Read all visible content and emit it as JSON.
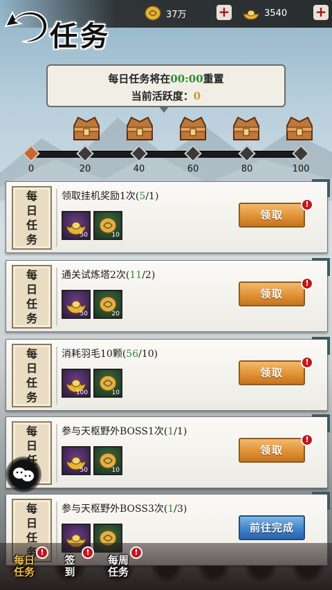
{
  "header": {
    "title": "任务",
    "currency": [
      {
        "icon": "gold-coin-icon",
        "amount": "37万"
      },
      {
        "icon": "gold-ingot-icon",
        "amount": "3540"
      }
    ]
  },
  "notice": {
    "line1_prefix": "每日任务将在",
    "reset_time": "00:00",
    "line1_suffix": "重置",
    "line2_prefix": "当前活跃度：",
    "activity": "0"
  },
  "progress": {
    "milestones": [
      "0",
      "20",
      "40",
      "60",
      "80",
      "100"
    ],
    "current": 0
  },
  "tasks": [
    {
      "tag": [
        "每",
        "日",
        "任",
        "务"
      ],
      "name": "领取挂机奖励1次",
      "done": "5",
      "total": "/1",
      "rewards": [
        {
          "icon": "gold-ingot-icon",
          "count": "50"
        },
        {
          "icon": "copper-coin-icon",
          "count": "10"
        }
      ],
      "button": "领取"
    },
    {
      "tag": [
        "每",
        "日",
        "任",
        "务"
      ],
      "name": "通关试炼塔2次",
      "done": "11",
      "total": "/2",
      "rewards": [
        {
          "icon": "gold-ingot-icon",
          "count": "50"
        },
        {
          "icon": "copper-coin-icon",
          "count": "20"
        }
      ],
      "button": "领取"
    },
    {
      "tag": [
        "每",
        "日",
        "任",
        "务"
      ],
      "name": "消耗羽毛10颗",
      "done": "56",
      "total": "/10",
      "rewards": [
        {
          "icon": "gold-ingot-icon",
          "count": "100"
        },
        {
          "icon": "copper-coin-icon",
          "count": "10"
        }
      ],
      "button": "领取"
    },
    {
      "tag": [
        "每",
        "日",
        "任",
        "务"
      ],
      "name": "参与天枢野外BOSS1次",
      "done": "1",
      "total": "/1",
      "rewards": [
        {
          "icon": "gold-ingot-icon",
          "count": "50"
        },
        {
          "icon": "copper-coin-icon",
          "count": "10"
        }
      ],
      "button": "领取"
    },
    {
      "tag": [
        "每",
        "日",
        "任",
        "务"
      ],
      "name": "参与天枢野外BOSS3次",
      "done": "1",
      "total": "/3",
      "rewards": [
        {
          "icon": "gold-ingot-icon",
          "count": ""
        },
        {
          "icon": "copper-coin-icon",
          "count": ""
        }
      ],
      "button": "前往完成"
    }
  ],
  "bottom_nav": [
    {
      "line1": "每日",
      "line2": "任务",
      "alert": "!"
    },
    {
      "line1": "签",
      "line2": "到",
      "alert": "!"
    },
    {
      "line1": "每周",
      "line2": "任务",
      "alert": "!"
    },
    {
      "line1": "",
      "line2": "",
      "alert": ""
    },
    {
      "line1": "",
      "line2": "",
      "alert": ""
    },
    {
      "line1": "",
      "line2": "",
      "alert": ""
    },
    {
      "line1": "",
      "line2": "",
      "alert": ""
    }
  ],
  "colors": {
    "accent_green": "#2d8a34",
    "button_orange": "#e09237",
    "button_blue": "#3f84cc",
    "alert_red": "#c0181c"
  }
}
